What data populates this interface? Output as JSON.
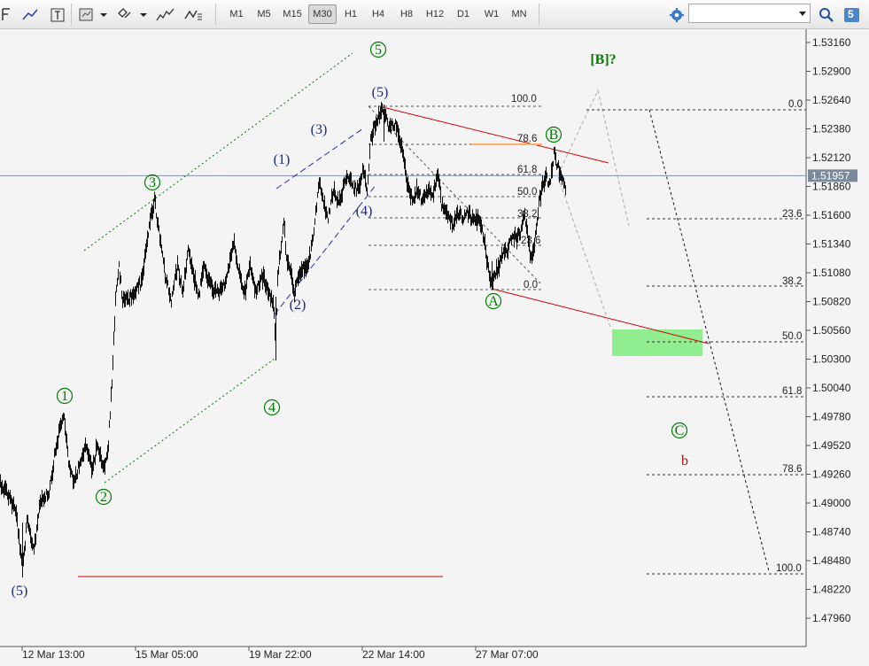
{
  "toolbar": {
    "timeframes": [
      "M1",
      "M5",
      "M15",
      "M30",
      "H1",
      "H4",
      "H8",
      "H12",
      "D1",
      "W1",
      "MN"
    ],
    "active_timeframe": "M30",
    "search_placeholder": "",
    "notifications_badge": "5"
  },
  "colors": {
    "wave_green": "#007a00",
    "wave_navy": "#1a2a80",
    "trend_red": "#d00000",
    "target_zone": "#90ee90",
    "price_line": "#8090b0",
    "bid_label_bg": "#7b8a9a"
  },
  "axis": {
    "price_labels": [
      "1.53160",
      "1.52900",
      "1.52640",
      "1.52380",
      "1.52120",
      "1.51860",
      "1.51600",
      "1.51340",
      "1.51080",
      "1.50820",
      "1.50560",
      "1.50300",
      "1.50040",
      "1.49780",
      "1.49520",
      "1.49260",
      "1.49000",
      "1.48740",
      "1.48480",
      "1.48220",
      "1.47960"
    ],
    "current_price": "1.51957",
    "time_labels": [
      "12 Mar 13:00",
      "15 Mar 05:00",
      "19 Mar 22:00",
      "22 Mar 14:00",
      "27 Mar 07:00"
    ]
  },
  "fib_retrace": [
    "100.0",
    "78.6",
    "61.8",
    "50.0",
    "38.2",
    "23.6",
    "0.0"
  ],
  "fib_extension": [
    "0.0",
    "23.6",
    "38.2",
    "50.0",
    "61.8",
    "78.6",
    "100.0"
  ],
  "waves": {
    "green": [
      "1",
      "2",
      "3",
      "4",
      "5",
      "A",
      "B",
      "C"
    ],
    "navy_top": "(5)",
    "navy_bottom": "(5)",
    "navy_sub": [
      "(1)",
      "(2)",
      "(3)",
      "(4)"
    ],
    "bracket_b": "[B]?",
    "minor_b": "b"
  }
}
